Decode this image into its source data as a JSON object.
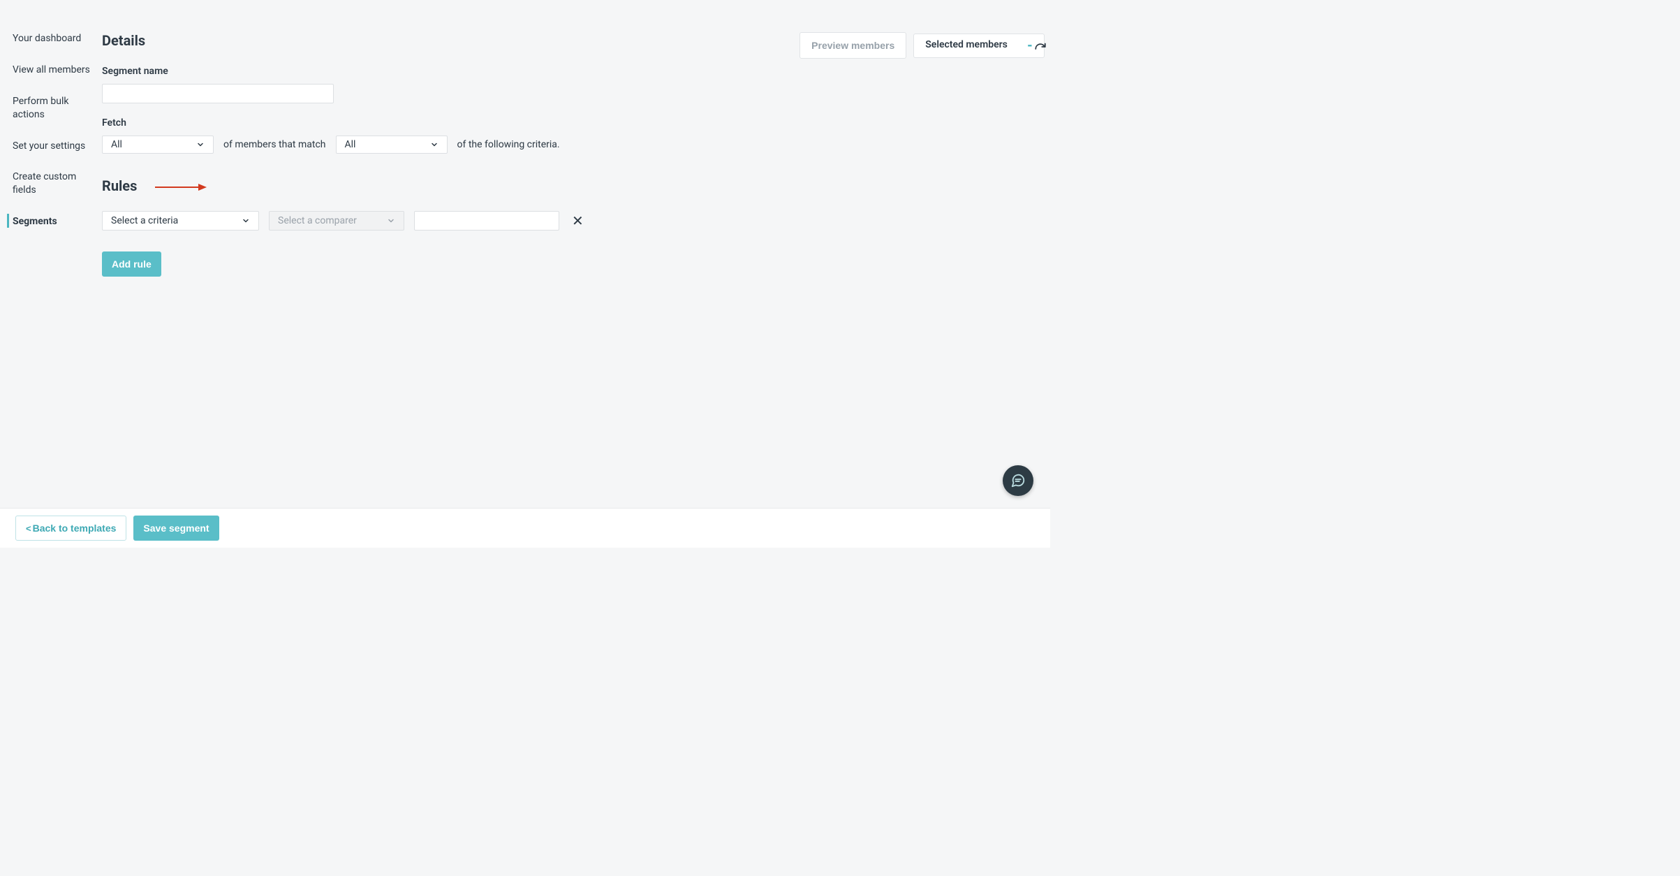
{
  "sidebar": {
    "items": [
      {
        "label": "Your dashboard"
      },
      {
        "label": "View all members"
      },
      {
        "label": "Perform bulk actions"
      },
      {
        "label": "Set your settings"
      },
      {
        "label": "Create custom fields"
      },
      {
        "label": "Segments"
      }
    ],
    "active_index": 5
  },
  "top_right": {
    "preview_label": "Preview members",
    "selected_label": "Selected members",
    "selected_value": "-"
  },
  "details": {
    "heading": "Details",
    "segment_name_label": "Segment name",
    "segment_name_value": "",
    "fetch_label": "Fetch",
    "fetch_quantity": "All",
    "fetch_mid_text": "of members that match",
    "fetch_match": "All",
    "fetch_tail_text": "of the following criteria."
  },
  "rules": {
    "heading": "Rules",
    "criteria_placeholder": "Select a criteria",
    "comparer_placeholder": "Select a comparer",
    "value": "",
    "add_rule_label": "Add rule"
  },
  "footer": {
    "back_label": "Back to templates",
    "save_label": "Save segment"
  }
}
